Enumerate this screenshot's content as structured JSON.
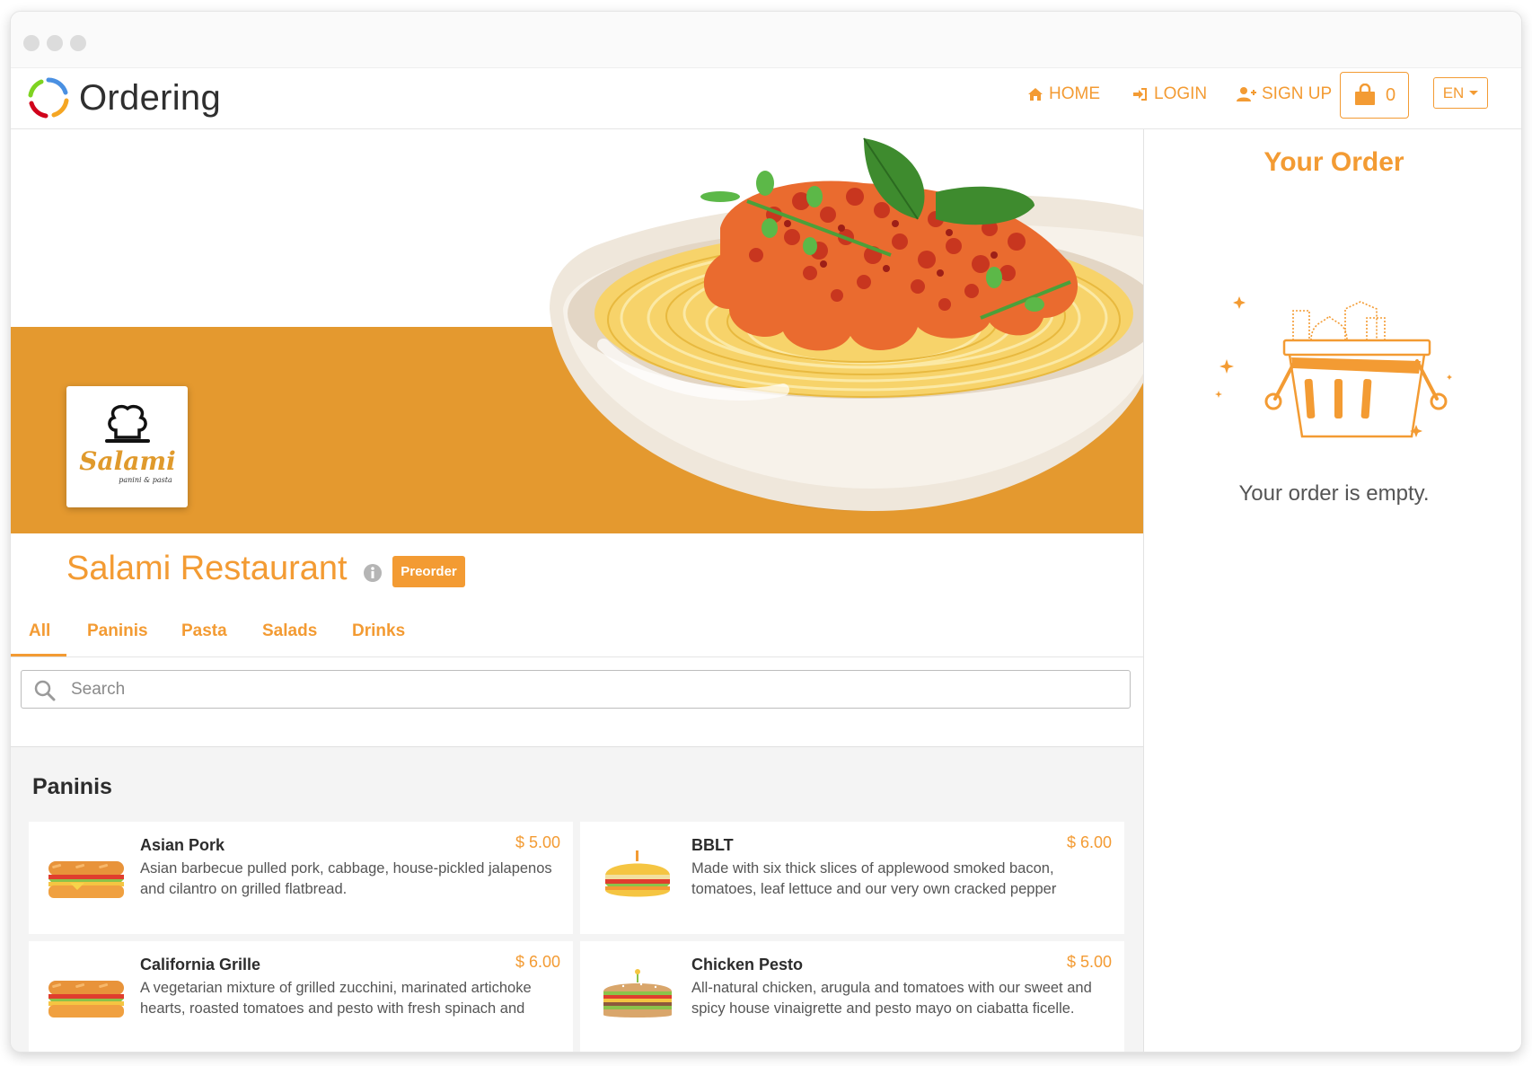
{
  "app": {
    "logo_text": "Ordering"
  },
  "nav": {
    "home": "HOME",
    "login": "LOGIN",
    "signup": "SIGN UP",
    "cart_count": "0",
    "language": "EN"
  },
  "store": {
    "name": "Salami Restaurant",
    "badge": "Preorder",
    "logo_text": "Salami",
    "logo_subtext": "panini & pasta"
  },
  "tabs": [
    {
      "label": "All",
      "active": true
    },
    {
      "label": "Paninis"
    },
    {
      "label": "Pasta"
    },
    {
      "label": "Salads"
    },
    {
      "label": "Drinks"
    }
  ],
  "search": {
    "placeholder": "Search"
  },
  "section": {
    "title": "Paninis"
  },
  "products": [
    {
      "name": "Asian Pork",
      "price": "$ 5.00",
      "description": "Asian barbecue pulled pork, cabbage, house-pickled jalapenos and cilantro on grilled flatbread.",
      "icon": "baguette-sandwich-icon"
    },
    {
      "name": "BBLT",
      "price": "$ 6.00",
      "description": "Made with six thick slices of applewood smoked bacon, tomatoes, leaf lettuce and our very own cracked pepper",
      "icon": "burger-sandwich-icon"
    },
    {
      "name": "California Grille",
      "price": "$ 6.00",
      "description": "A vegetarian mixture of grilled zucchini, marinated artichoke hearts, roasted tomatoes and pesto with fresh spinach and",
      "icon": "baguette-sandwich-icon"
    },
    {
      "name": "Chicken Pesto",
      "price": "$ 5.00",
      "description": "All-natural chicken, arugula and tomatoes with our sweet and spicy house vinaigrette and pesto mayo on ciabatta ficelle.",
      "icon": "club-sandwich-icon"
    }
  ],
  "order": {
    "title": "Your Order",
    "empty_message": "Your order is empty."
  },
  "colors": {
    "accent": "#f39b33",
    "banner_band": "#e4992f"
  }
}
